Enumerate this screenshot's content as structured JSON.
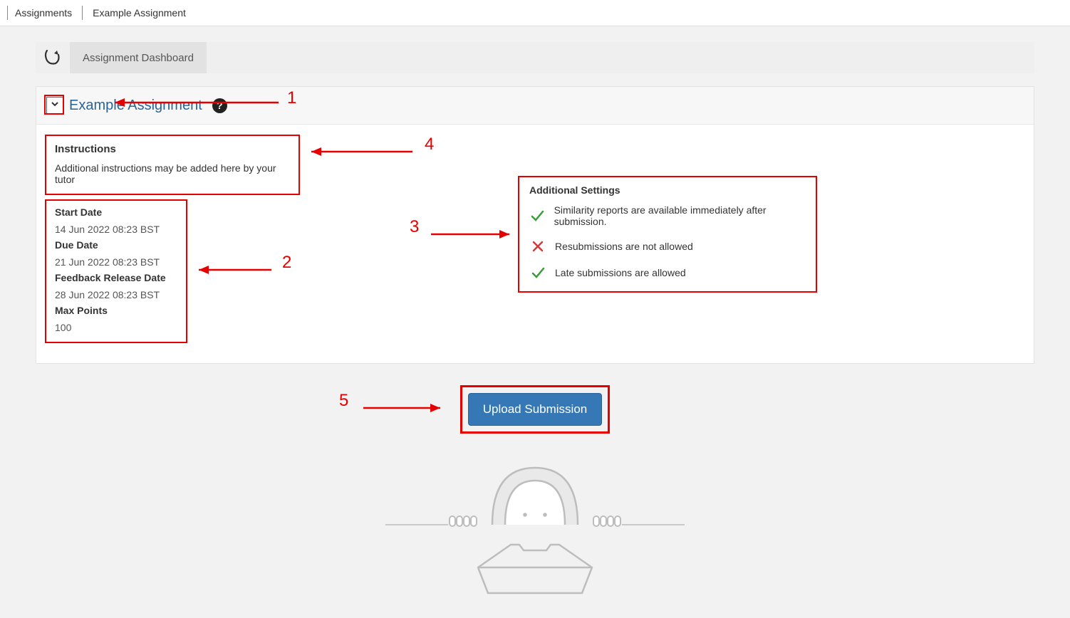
{
  "breadcrumb": {
    "root": "Assignments",
    "current": "Example Assignment"
  },
  "dashboard": {
    "tab_label": "Assignment Dashboard"
  },
  "assignment": {
    "title": "Example Assignment",
    "help_glyph": "?"
  },
  "instructions": {
    "label": "Instructions",
    "text": "Additional instructions may be added here by your tutor"
  },
  "dates": {
    "start_label": "Start Date",
    "start_value": "14 Jun 2022 08:23 BST",
    "due_label": "Due Date",
    "due_value": "21 Jun 2022 08:23 BST",
    "feedback_label": "Feedback Release Date",
    "feedback_value": "28 Jun 2022 08:23 BST",
    "max_points_label": "Max Points",
    "max_points_value": "100"
  },
  "settings": {
    "label": "Additional Settings",
    "items": [
      {
        "icon": "check",
        "text": "Similarity reports are available immediately after submission."
      },
      {
        "icon": "cross",
        "text": "Resubmissions are not allowed"
      },
      {
        "icon": "check",
        "text": "Late submissions are allowed"
      }
    ]
  },
  "upload": {
    "button_label": "Upload Submission"
  },
  "annotations": {
    "n1": "1",
    "n2": "2",
    "n3": "3",
    "n4": "4",
    "n5": "5"
  }
}
